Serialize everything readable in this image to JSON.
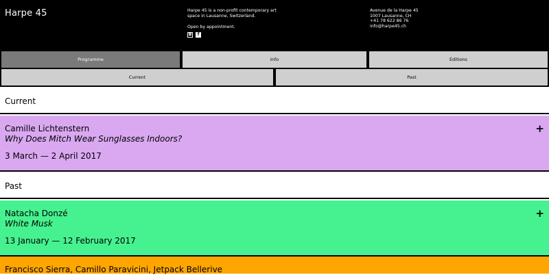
{
  "header": {
    "logo": "Harpe 45",
    "about_line1": "Harpe 45 is a non-profit contemporary art",
    "about_line2": "space in Lausanne, Switzerland.",
    "about_line3": "Open by appointment.",
    "contact": [
      "Avenue de la Harpe 45",
      "1007 Lausanne, CH",
      "+41 78 622 86 76",
      "info@harpe45.ch"
    ],
    "social_icons": [
      "instagram-icon",
      "facebook-icon"
    ]
  },
  "nav": {
    "primary": [
      "Programme",
      "Info",
      "Editions"
    ],
    "primary_active": "Programme",
    "secondary": [
      "Current",
      "Past"
    ]
  },
  "sections": {
    "current_title": "Current",
    "past_title": "Past"
  },
  "exhibits": [
    {
      "artist": "Camille Lichtenstern",
      "title": "Why Does Mitch Wear Sunglasses Indoors?",
      "dates": "3 March — 2 April 2017",
      "color": "#d9a8f0"
    },
    {
      "artist": "Natacha Donzé",
      "title": "White Musk",
      "dates": "13 January — 12 February 2017",
      "color": "#46f28f"
    },
    {
      "artist": "Francisco Sierra, Camillo Paravicini, Jetpack Bellerive",
      "title": "",
      "dates": "",
      "color": "#ffa500"
    }
  ],
  "expand_symbol": "+"
}
